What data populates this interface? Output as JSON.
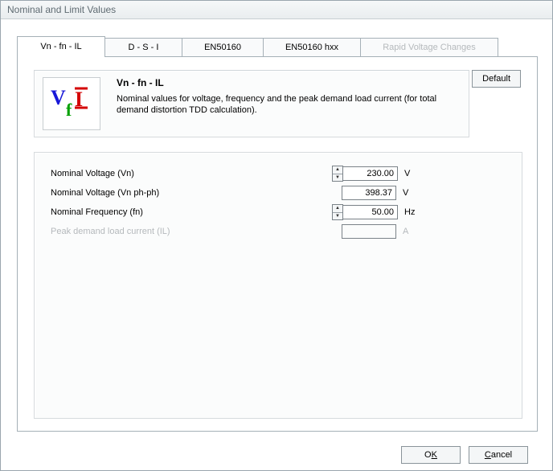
{
  "window": {
    "title": "Nominal and Limit Values"
  },
  "tabs": [
    {
      "label": "Vn - fn - IL",
      "active": true,
      "disabled": false
    },
    {
      "label": "D - S - I",
      "active": false,
      "disabled": false
    },
    {
      "label": "EN50160",
      "active": false,
      "disabled": false
    },
    {
      "label": "EN50160 hxx",
      "active": false,
      "disabled": false
    },
    {
      "label": "Rapid Voltage Changes",
      "active": false,
      "disabled": true
    }
  ],
  "header": {
    "title": "Vn - fn - IL",
    "description": "Nominal values for voltage, frequency and the peak demand load current (for total demand distortion TDD calculation)."
  },
  "buttons": {
    "default": "Default",
    "ok_prefix": "O",
    "ok_key": "K",
    "cancel_key": "C",
    "cancel_rest": "ancel"
  },
  "fields": {
    "vn": {
      "label": "Nominal Voltage (Vn)",
      "value": "230.00",
      "unit": "V",
      "spinner": true,
      "enabled": true,
      "editable": true
    },
    "vn_phph": {
      "label": "Nominal Voltage (Vn ph-ph)",
      "value": "398.37",
      "unit": "V",
      "spinner": false,
      "enabled": true,
      "editable": false
    },
    "fn": {
      "label": "Nominal Frequency (fn)",
      "value": "50.00",
      "unit": "Hz",
      "spinner": true,
      "enabled": true,
      "editable": true
    },
    "il": {
      "label": "Peak demand load current (IL)",
      "value": "",
      "unit": "A",
      "spinner": false,
      "enabled": false,
      "editable": false
    }
  },
  "icon": {
    "name": "vfi-icon"
  }
}
